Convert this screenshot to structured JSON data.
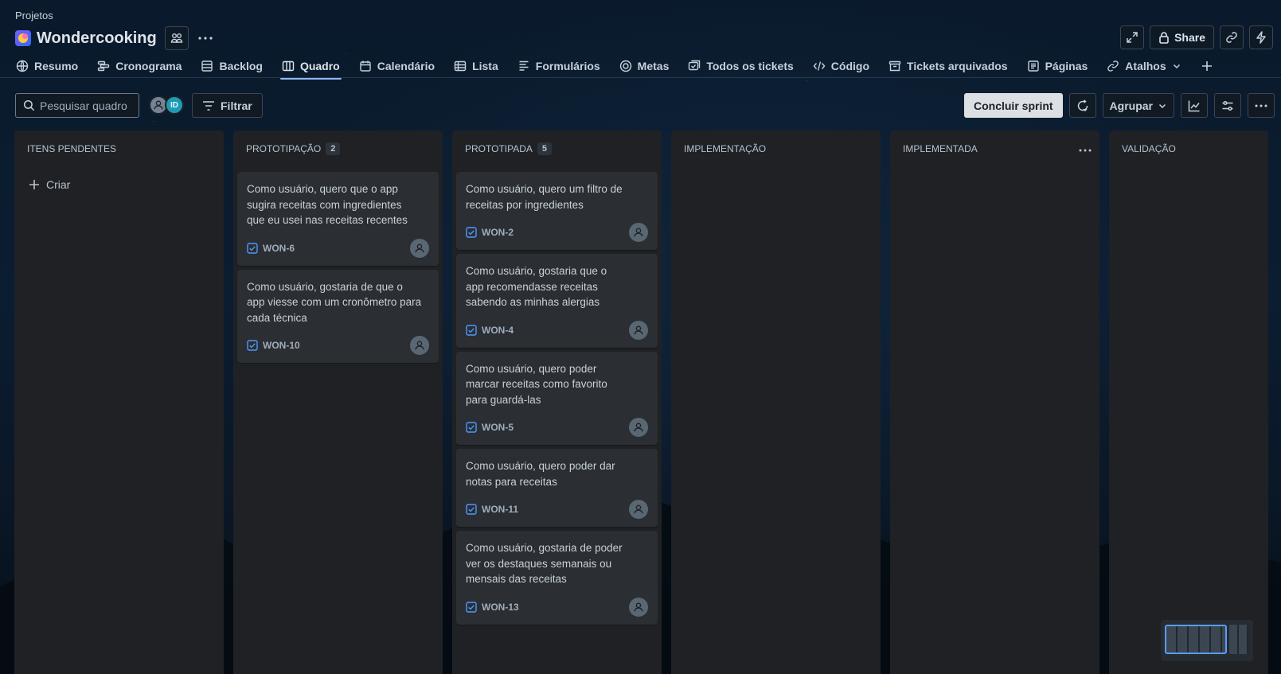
{
  "breadcrumb": "Projetos",
  "project": {
    "name": "Wondercooking"
  },
  "top_actions": {
    "share_label": "Share"
  },
  "tabs": [
    {
      "label": "Resumo",
      "icon": "globe-icon"
    },
    {
      "label": "Cronograma",
      "icon": "timeline-icon"
    },
    {
      "label": "Backlog",
      "icon": "backlog-icon"
    },
    {
      "label": "Quadro",
      "icon": "board-icon",
      "active": true
    },
    {
      "label": "Calendário",
      "icon": "calendar-icon"
    },
    {
      "label": "Lista",
      "icon": "list-icon"
    },
    {
      "label": "Formulários",
      "icon": "form-icon"
    },
    {
      "label": "Metas",
      "icon": "target-icon"
    },
    {
      "label": "Todos os tickets",
      "icon": "tickets-icon"
    },
    {
      "label": "Código",
      "icon": "code-icon"
    },
    {
      "label": "Tickets arquivados",
      "icon": "archive-icon"
    },
    {
      "label": "Páginas",
      "icon": "pages-icon"
    },
    {
      "label": "Atalhos",
      "icon": "link-icon"
    }
  ],
  "toolbar": {
    "search_placeholder": "Pesquisar quadro",
    "avatar_initials": "ID",
    "filter_label": "Filtrar",
    "complete_sprint_label": "Concluir sprint",
    "group_label": "Agrupar"
  },
  "columns": [
    {
      "title": "ITENS PENDENTES",
      "count": "",
      "create_label": "Criar",
      "cards": []
    },
    {
      "title": "PROTOTIPAÇÃO",
      "count": "2",
      "cards": [
        {
          "title": "Como usuário, quero que o app sugira receitas com ingredientes que eu usei nas receitas recentes",
          "key": "WON-6"
        },
        {
          "title": "Como usuário, gostaria de que o app viesse com um cronômetro para cada técnica",
          "key": "WON-10"
        }
      ]
    },
    {
      "title": "PROTOTIPADA",
      "count": "5",
      "cards": [
        {
          "title": "Como usuário, quero um filtro de receitas por ingredientes",
          "key": "WON-2"
        },
        {
          "title": "Como usuário, gostaria que o app recomendasse receitas sabendo as minhas alergias",
          "key": "WON-4"
        },
        {
          "title": "Como usuário, quero poder marcar receitas como favorito para guardá-las",
          "key": "WON-5"
        },
        {
          "title": "Como usuário, quero poder dar notas para receitas",
          "key": "WON-11"
        },
        {
          "title": "Como usuário, gostaria de poder ver os destaques semanais ou mensais das receitas",
          "key": "WON-13"
        }
      ]
    },
    {
      "title": "IMPLEMENTAÇÃO",
      "count": "",
      "cards": []
    },
    {
      "title": "IMPLEMENTADA",
      "count": "",
      "cards": []
    },
    {
      "title": "VALIDAÇÃO",
      "count": "",
      "cards": []
    }
  ],
  "colors": {
    "accent": "#8fb8f6",
    "column_bg": "#1f2124",
    "card_bg": "#2b2e32",
    "checkbox": "#4c9aff"
  }
}
